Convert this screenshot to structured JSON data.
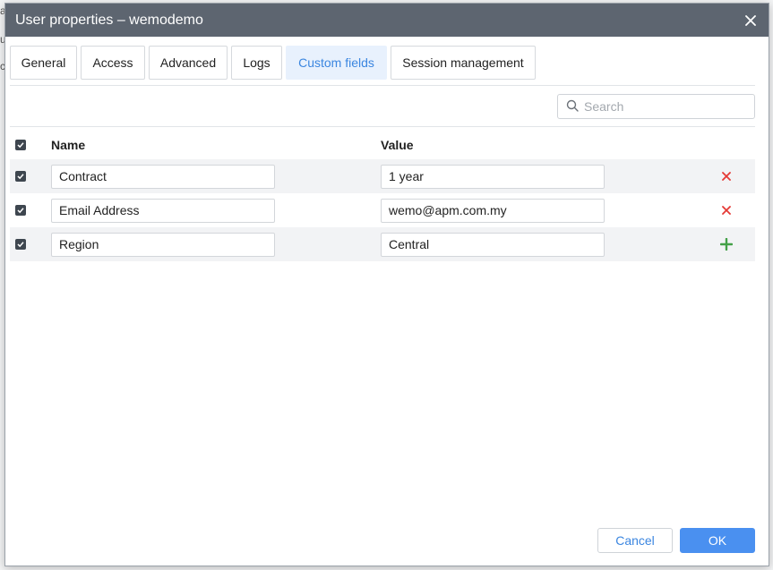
{
  "window": {
    "title": "User properties – wemodemo",
    "close_icon": "close-icon"
  },
  "background": {
    "chars": [
      "a",
      "u",
      "c"
    ]
  },
  "tabs": [
    {
      "label": "General",
      "active": false
    },
    {
      "label": "Access",
      "active": false
    },
    {
      "label": "Advanced",
      "active": false
    },
    {
      "label": "Logs",
      "active": false
    },
    {
      "label": "Custom fields",
      "active": true
    },
    {
      "label": "Session management",
      "active": false
    }
  ],
  "search": {
    "placeholder": "Search",
    "value": "",
    "icon": "search-icon"
  },
  "table": {
    "headers": {
      "name": "Name",
      "value": "Value"
    },
    "header_checked": true,
    "rows": [
      {
        "checked": true,
        "name": "Contract",
        "value": "1 year",
        "action": "remove",
        "action_icon": "delete-icon"
      },
      {
        "checked": true,
        "name": "Email Address",
        "value": "wemo@apm.com.my",
        "action": "remove",
        "action_icon": "delete-icon"
      },
      {
        "checked": true,
        "name": "Region",
        "value": "Central",
        "action": "add",
        "action_icon": "add-icon"
      }
    ]
  },
  "footer": {
    "cancel_label": "Cancel",
    "ok_label": "OK"
  },
  "colors": {
    "titlebar": "#5d6570",
    "accent": "#3b86e0",
    "ok_button": "#4a90f0",
    "delete": "#e53935",
    "add": "#43a047",
    "active_tab_bg": "#e8f1fd"
  }
}
